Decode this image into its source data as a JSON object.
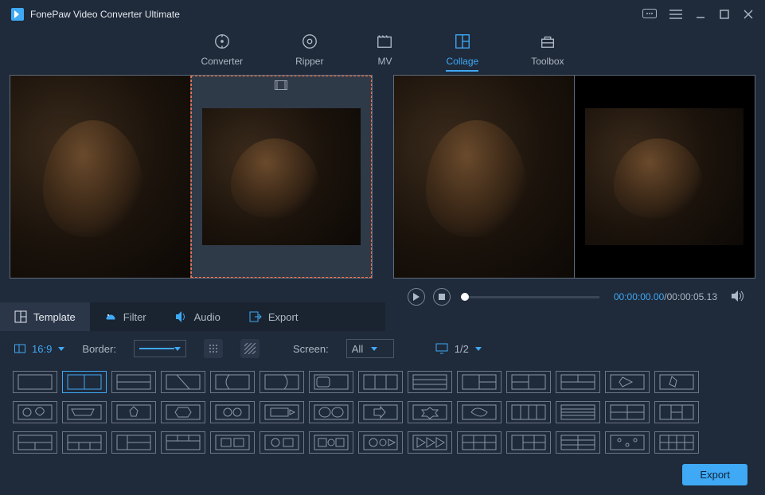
{
  "app": {
    "title": "FonePaw Video Converter Ultimate"
  },
  "nav": {
    "items": [
      {
        "label": "Converter"
      },
      {
        "label": "Ripper"
      },
      {
        "label": "MV"
      },
      {
        "label": "Collage"
      },
      {
        "label": "Toolbox"
      }
    ],
    "active": "Collage"
  },
  "tabs": {
    "items": [
      {
        "label": "Template"
      },
      {
        "label": "Filter"
      },
      {
        "label": "Audio"
      },
      {
        "label": "Export"
      }
    ],
    "active": "Template"
  },
  "toolbar": {
    "ratio": "16:9",
    "border_label": "Border:",
    "screen_label": "Screen:",
    "screen_value": "All",
    "page_display": "1/2"
  },
  "player": {
    "time_current": "00:00:00.00",
    "time_total": "00:00:05.13",
    "separator": "/"
  },
  "footer": {
    "export_label": "Export"
  }
}
